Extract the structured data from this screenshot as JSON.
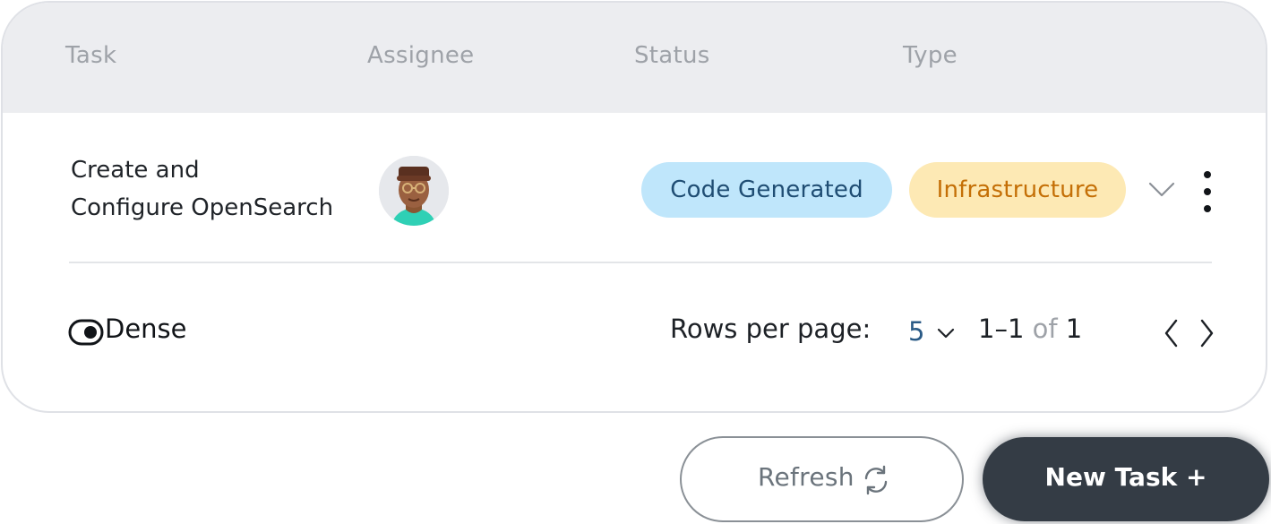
{
  "table": {
    "headers": {
      "task": "Task",
      "assignee": "Assignee",
      "status": "Status",
      "type": "Type"
    },
    "rows": [
      {
        "task_line1": "Create and",
        "task_line2": "Configure OpenSearch",
        "assignee_avatar": "avatar-3d-person",
        "status": "Code Generated",
        "type": "Infrastructure"
      }
    ]
  },
  "footer": {
    "dense_label": "Dense",
    "dense_enabled": true,
    "rows_per_page_label": "Rows per page:",
    "rows_per_page_value": "5",
    "range_start": "1–1",
    "range_of": "of",
    "range_total": "1"
  },
  "actions": {
    "refresh_label": "Refresh",
    "new_task_label": "New Task +"
  },
  "colors": {
    "header_bg": "#ecedf0",
    "status_pill_bg": "#bfe6fb",
    "status_pill_text": "#1f4d73",
    "type_pill_bg": "#fde9b4",
    "type_pill_text": "#c46f06",
    "primary_button": "#343c45"
  },
  "icons": {
    "row_expand": "chevron-down-icon",
    "row_menu": "more-vertical-icon",
    "rows_select": "chevron-down-icon",
    "prev": "chevron-left-icon",
    "next": "chevron-right-icon",
    "refresh": "refresh-icon",
    "dense": "toggle-icon"
  }
}
